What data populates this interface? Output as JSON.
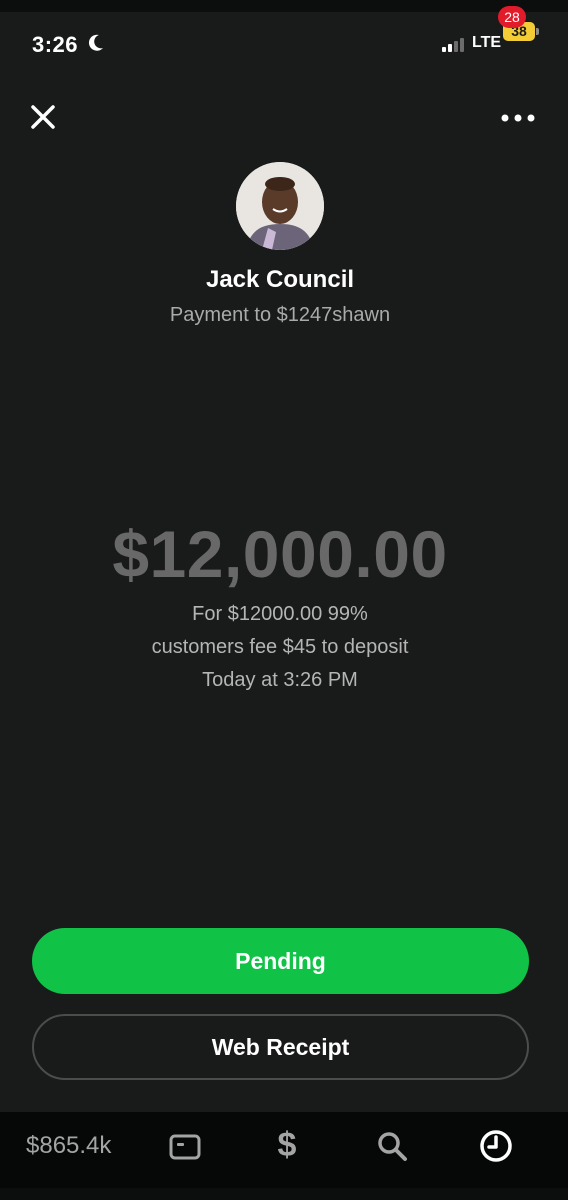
{
  "status_bar": {
    "time": "3:26",
    "network": "LTE",
    "battery": "38",
    "icons": [
      "moon-icon",
      "signal-icon"
    ]
  },
  "header": {
    "close_icon": "close-icon",
    "more_icon": "more-icon"
  },
  "payment": {
    "recipient_name": "Jack Council",
    "payment_to": "Payment to $1247shawn",
    "amount": "$12,000.00",
    "note_line1": "For $12000.00 99%",
    "note_line2": "customers fee $45 to deposit",
    "timestamp": "Today at 3:26 PM"
  },
  "actions": {
    "pending_label": "Pending",
    "receipt_label": "Web Receipt"
  },
  "tab_bar": {
    "balance": "$865.4k",
    "pay_symbol": "$",
    "activity_badge": "28",
    "icons": [
      "card-icon",
      "dollar-icon",
      "search-icon",
      "activity-icon"
    ]
  },
  "colors": {
    "background": "#191b1a",
    "accent_green": "#10c246",
    "amount_gray": "#676867",
    "badge_red": "#e21b2a",
    "battery_yellow": "#f4cd36"
  }
}
